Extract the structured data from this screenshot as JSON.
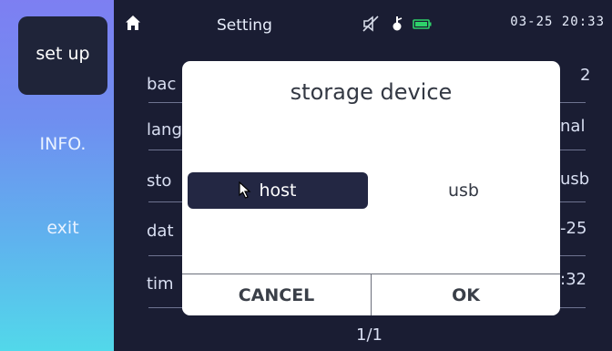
{
  "sidebar": {
    "items": [
      {
        "label": "set up"
      },
      {
        "label": "INFO."
      },
      {
        "label": "exit"
      }
    ]
  },
  "topbar": {
    "title": "Setting",
    "status_icons": [
      "mute-icon",
      "usb-icon",
      "battery-icon"
    ],
    "time": "03-25 20:33"
  },
  "background_rows": [
    {
      "left_text": "bac",
      "right_text": "2"
    },
    {
      "left_text": "lang",
      "right_text": "nal"
    },
    {
      "left_text": "sto",
      "right_text": "usb"
    },
    {
      "left_text": "dat",
      "right_text": "-25"
    },
    {
      "left_text": "tim",
      "right_text": ":32"
    }
  ],
  "page_indicator": "1/1",
  "dialog": {
    "title": "storage device",
    "options": [
      "host",
      "usb"
    ],
    "selected": "host",
    "cancel_label": "CANCEL",
    "ok_label": "OK"
  }
}
